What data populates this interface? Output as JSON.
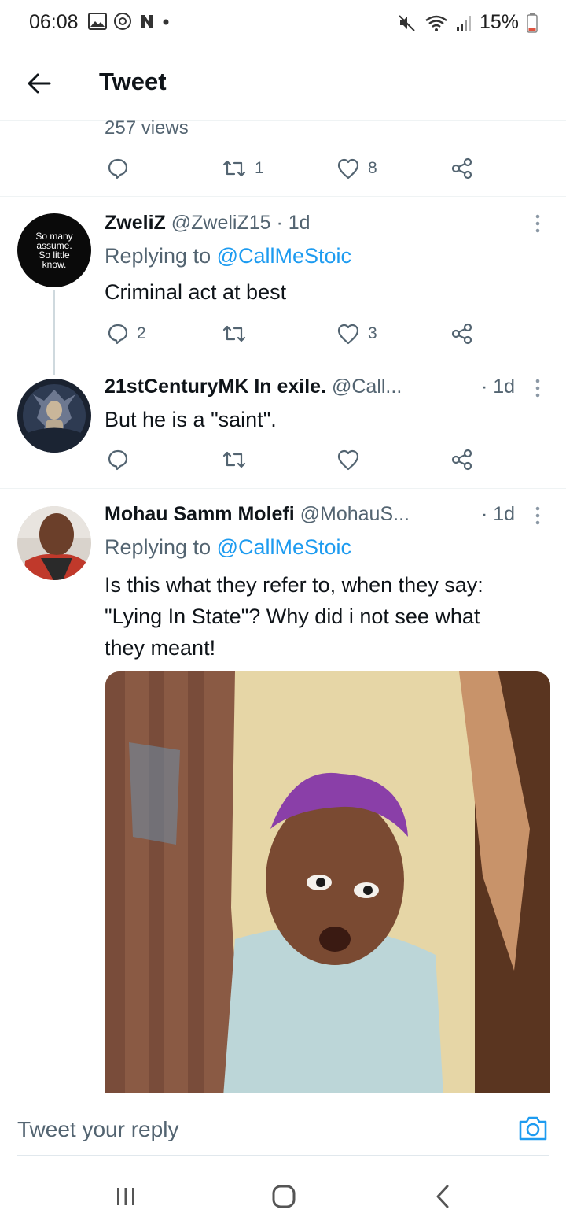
{
  "status": {
    "time": "06:08",
    "battery_pct": "15%",
    "icons_left": [
      "gallery-icon",
      "sync-icon",
      "n-app-icon",
      "dot-icon"
    ],
    "icons_right": [
      "mute-icon",
      "wifi-icon",
      "signal-icon",
      "battery-icon"
    ]
  },
  "header": {
    "title": "Tweet"
  },
  "main_tweet": {
    "views": "257 views",
    "actions": {
      "reply_count": "",
      "retweet_count": "1",
      "like_count": "8"
    }
  },
  "replies": [
    {
      "name": "ZweliZ",
      "handle": "@ZweliZ15",
      "time": "· 1d",
      "replying_prefix": "Replying to ",
      "replying_to": "@CallMeStoic",
      "text": "Criminal act at best",
      "avatar_text": [
        "So many",
        "assume.",
        "So little",
        "know."
      ],
      "actions": {
        "reply_count": "2",
        "retweet_count": "",
        "like_count": "3"
      }
    },
    {
      "name": "21stCenturyMK In exile.",
      "handle": "@Call...",
      "time": "· 1d",
      "text": "But he is a \"saint\".",
      "actions": {
        "reply_count": "",
        "retweet_count": "",
        "like_count": ""
      }
    },
    {
      "name": "Mohau Samm Molefi",
      "handle": "@MohauS...",
      "time": "· 1d",
      "replying_prefix": "Replying to ",
      "replying_to": "@CallMeStoic",
      "text_lines": [
        "Is this what they refer to,  when they say:",
        "\"Lying In State\"? Why did i not see what",
        "they meant!"
      ]
    }
  ],
  "composer": {
    "placeholder": "Tweet your reply"
  },
  "colors": {
    "accent": "#1d9bf0",
    "secondary_text": "#536471",
    "primary_text": "#0f1419"
  }
}
